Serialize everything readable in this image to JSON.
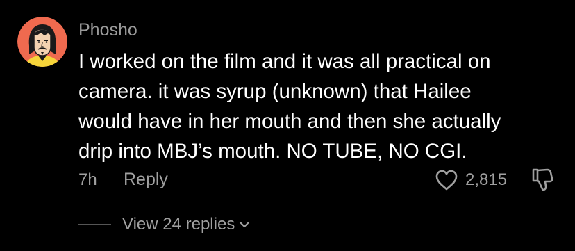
{
  "comment": {
    "username": "Phosho",
    "text_lines": [
      "I worked on the film and it was all practical on",
      "camera. it was syrup (unknown) that Hailee",
      "would have in her mouth and then she actually",
      "drip into MBJ’s mouth. NO TUBE, NO CGI."
    ],
    "time_ago": "7h",
    "reply_label": "Reply",
    "like_count": "2,815",
    "view_replies_label": "View 24 replies"
  },
  "icons": {
    "avatar": "cartoon-face-avatar",
    "like": "heart-outline-icon",
    "dislike": "thumbs-down-icon",
    "expand": "chevron-down-icon"
  },
  "colors": {
    "background": "#000000",
    "primary_text": "#ffffff",
    "secondary_text": "#a0a0a0",
    "avatar_bg": "#ef6a4f",
    "avatar_accent": "#f6d53a"
  }
}
